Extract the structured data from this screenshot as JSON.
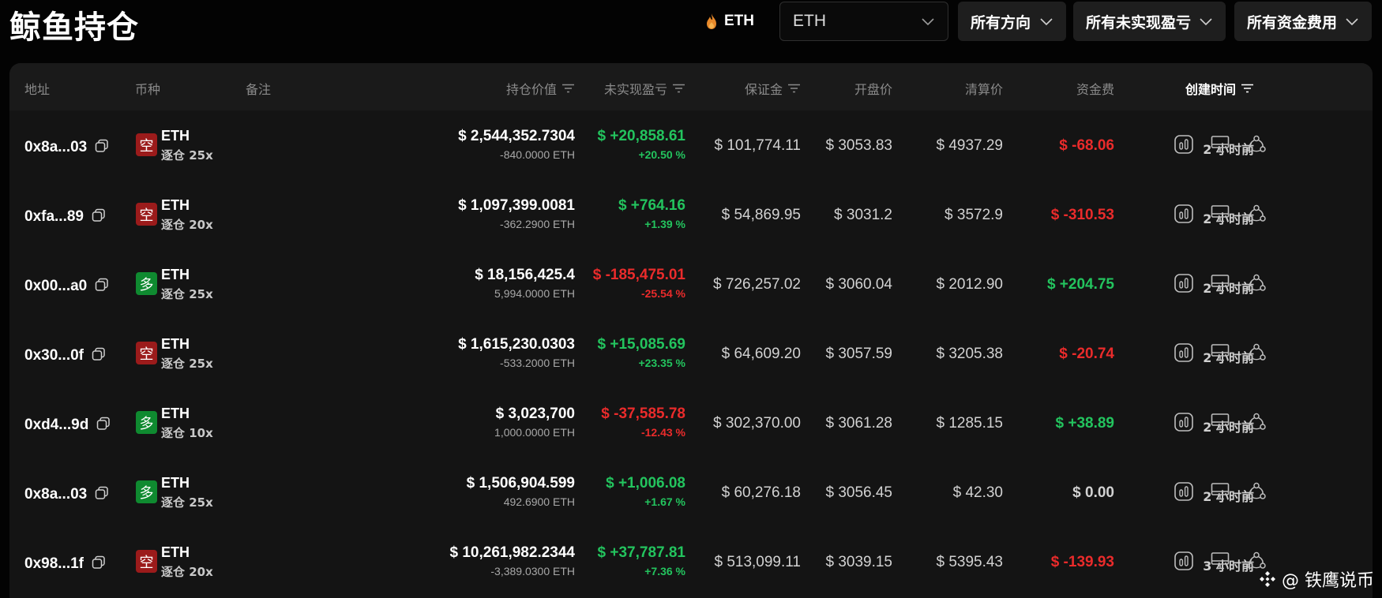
{
  "header": {
    "title": "鲸鱼持仓",
    "coin_chip": "ETH",
    "coin_select": "ETH",
    "filters": [
      "所有方向",
      "所有未实现盈亏",
      "所有资金费用"
    ]
  },
  "columns": {
    "address": "地址",
    "coin": "币种",
    "note": "备注",
    "position_value": "持仓价值",
    "unrealized_pnl": "未实现盈亏",
    "margin": "保证金",
    "entry_price": "开盘价",
    "liq_price": "清算价",
    "funding": "资金费",
    "created": "创建时间"
  },
  "colors": {
    "green": "#23c45e",
    "red": "#ea2b2b",
    "short_badge": "#9b1b1b",
    "long_badge": "#0f8a30"
  },
  "rows": [
    {
      "address": "0x8a...03",
      "side": "空",
      "side_type": "short",
      "coin": "ETH",
      "leverage": "逐仓 25x",
      "value": "$ 2,544,352.7304",
      "size": "-840.0000 ETH",
      "pnl": "$ +20,858.61",
      "pnl_pct": "+20.50 %",
      "pnl_sign": "pos",
      "margin": "$ 101,774.11",
      "entry": "$ 3053.83",
      "liq": "$ 4937.29",
      "funding": "$ -68.06",
      "funding_sign": "neg",
      "time": "2 小时前"
    },
    {
      "address": "0xfa...89",
      "side": "空",
      "side_type": "short",
      "coin": "ETH",
      "leverage": "逐仓 20x",
      "value": "$ 1,097,399.0081",
      "size": "-362.2900 ETH",
      "pnl": "$ +764.16",
      "pnl_pct": "+1.39 %",
      "pnl_sign": "pos",
      "margin": "$ 54,869.95",
      "entry": "$ 3031.2",
      "liq": "$ 3572.9",
      "funding": "$ -310.53",
      "funding_sign": "neg",
      "time": "2 小时前"
    },
    {
      "address": "0x00...a0",
      "side": "多",
      "side_type": "long",
      "coin": "ETH",
      "leverage": "逐仓 25x",
      "value": "$ 18,156,425.4",
      "size": "5,994.0000 ETH",
      "pnl": "$ -185,475.01",
      "pnl_pct": "-25.54 %",
      "pnl_sign": "neg",
      "margin": "$ 726,257.02",
      "entry": "$ 3060.04",
      "liq": "$ 2012.90",
      "funding": "$ +204.75",
      "funding_sign": "pos",
      "time": "2 小时前"
    },
    {
      "address": "0x30...0f",
      "side": "空",
      "side_type": "short",
      "coin": "ETH",
      "leverage": "逐仓 25x",
      "value": "$ 1,615,230.0303",
      "size": "-533.2000 ETH",
      "pnl": "$ +15,085.69",
      "pnl_pct": "+23.35 %",
      "pnl_sign": "pos",
      "margin": "$ 64,609.20",
      "entry": "$ 3057.59",
      "liq": "$ 3205.38",
      "funding": "$ -20.74",
      "funding_sign": "neg",
      "time": "2 小时前"
    },
    {
      "address": "0xd4...9d",
      "side": "多",
      "side_type": "long",
      "coin": "ETH",
      "leverage": "逐仓 10x",
      "value": "$ 3,023,700",
      "size": "1,000.0000 ETH",
      "pnl": "$ -37,585.78",
      "pnl_pct": "-12.43 %",
      "pnl_sign": "neg",
      "margin": "$ 302,370.00",
      "entry": "$ 3061.28",
      "liq": "$ 1285.15",
      "funding": "$ +38.89",
      "funding_sign": "pos",
      "time": "2 小时前"
    },
    {
      "address": "0x8a...03",
      "side": "多",
      "side_type": "long",
      "coin": "ETH",
      "leverage": "逐仓 25x",
      "value": "$ 1,506,904.599",
      "size": "492.6900 ETH",
      "pnl": "$ +1,006.08",
      "pnl_pct": "+1.67 %",
      "pnl_sign": "pos",
      "margin": "$ 60,276.18",
      "entry": "$ 3056.45",
      "liq": "$ 42.30",
      "funding": "$ 0.00",
      "funding_sign": "zero",
      "time": "2 小时前"
    },
    {
      "address": "0x98...1f",
      "side": "空",
      "side_type": "short",
      "coin": "ETH",
      "leverage": "逐仓 20x",
      "value": "$ 10,261,982.2344",
      "size": "-3,389.0300 ETH",
      "pnl": "$ +37,787.81",
      "pnl_pct": "+7.36 %",
      "pnl_sign": "pos",
      "margin": "$ 513,099.11",
      "entry": "$ 3039.15",
      "liq": "$ 5395.43",
      "funding": "$ -139.93",
      "funding_sign": "neg",
      "time": "3 小时前"
    }
  ],
  "row_actions": [
    "chart-icon",
    "monitor-icon",
    "share-icon"
  ],
  "watermark": "@ 铁鹰说币"
}
